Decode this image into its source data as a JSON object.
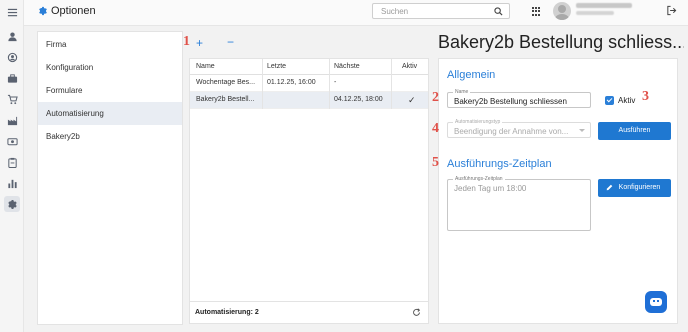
{
  "app": {
    "title": "Optionen"
  },
  "search": {
    "placeholder": "Suchen"
  },
  "rail": {
    "icons": [
      "menu-icon",
      "user-icon",
      "user-settings-icon",
      "briefcase-icon",
      "cart-icon",
      "factory-icon",
      "cash-icon",
      "clipboard-icon",
      "bar-chart-icon",
      "settings-icon"
    ]
  },
  "options": {
    "items": [
      {
        "label": "Firma"
      },
      {
        "label": "Konfiguration"
      },
      {
        "label": "Formulare"
      },
      {
        "label": "Automatisierung"
      },
      {
        "label": "Bakery2b"
      }
    ],
    "selected": "Automatisierung"
  },
  "grid": {
    "add_label": "+",
    "remove_label": "−",
    "columns": [
      "Name",
      "Letzte",
      "Nächste",
      "Aktiv"
    ],
    "rows": [
      {
        "name": "Wochentage Bes...",
        "last": "01.12.25, 16:00",
        "next": "-",
        "active": ""
      },
      {
        "name": "Bakery2b Bestell...",
        "last": "",
        "next": "04.12.25, 18:00",
        "active": "✓"
      }
    ],
    "footer": "Automatisierung: 2"
  },
  "detail": {
    "title": "Bakery2b Bestellung schliess...",
    "general_heading": "Allgemein",
    "name_label": "Name",
    "name_value": "Bakery2b Bestellung schliessen",
    "active_label": "Aktiv",
    "active_checked": true,
    "type_label": "Automatisierungstyp",
    "type_value": "Beendigung der Annahme von...",
    "run_button": "Ausführen",
    "schedule_heading": "Ausführungs-Zeitplan",
    "schedule_label": "Ausführungs-Zeitplan",
    "schedule_value": "Jeden Tag um 18:00",
    "configure_button": "Konfigurieren"
  },
  "annotations": [
    "1",
    "2",
    "3",
    "4",
    "5"
  ],
  "colors": {
    "accent": "#2a7fd8",
    "button": "#1f78d1",
    "marker": "#e0524a"
  }
}
